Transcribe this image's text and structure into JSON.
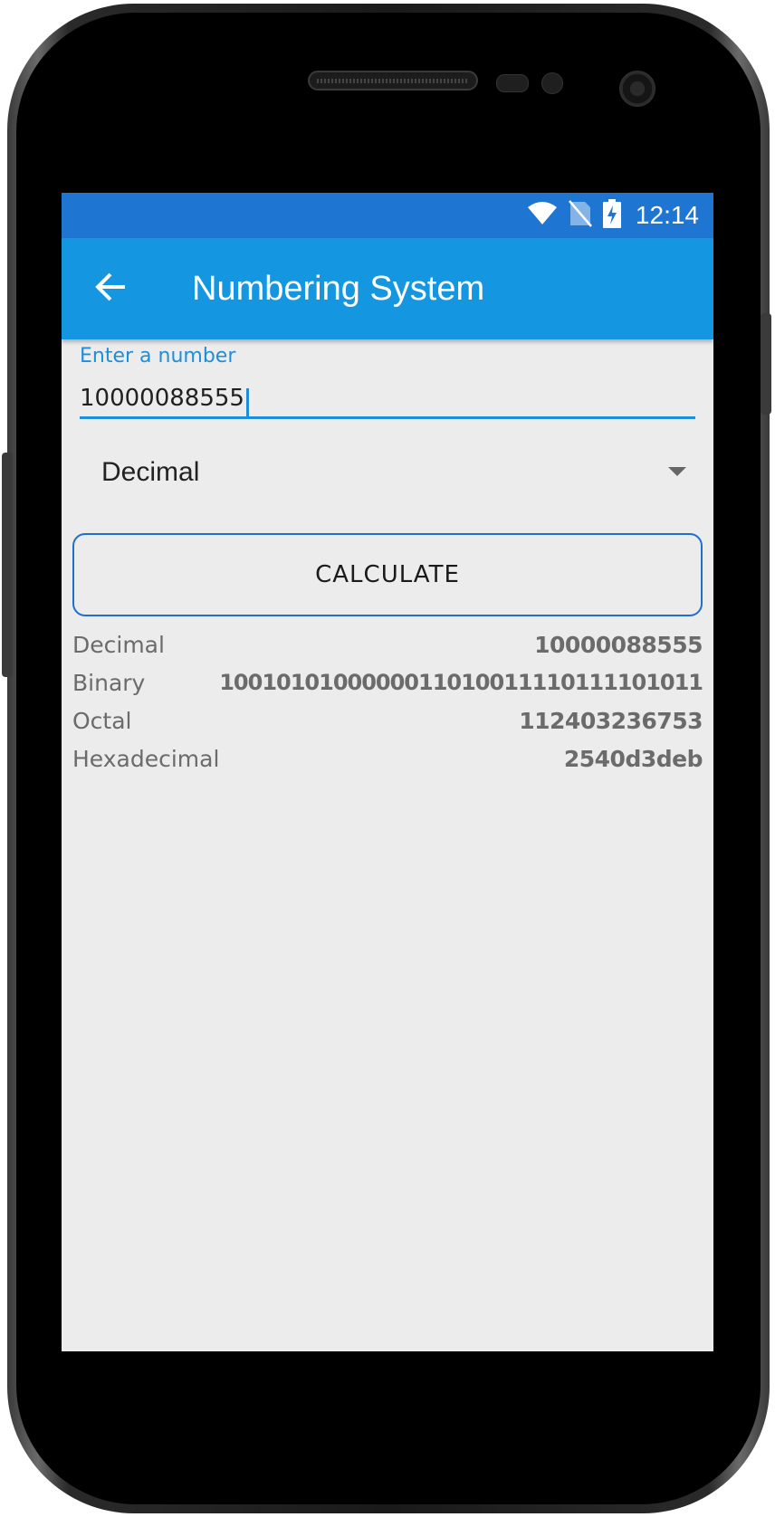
{
  "status_bar": {
    "time": "12:14",
    "icons": [
      "wifi-icon",
      "no-sim-icon",
      "battery-charging-icon"
    ]
  },
  "app_bar": {
    "back_icon": "arrow-left-icon",
    "title": "Numbering System"
  },
  "input": {
    "label": "Enter a number",
    "value": "10000088555"
  },
  "base_select": {
    "selected": "Decimal",
    "icon": "dropdown-arrow-icon"
  },
  "calculate_button": {
    "label": "CALCULATE"
  },
  "results": [
    {
      "label": "Decimal",
      "value": "10000088555"
    },
    {
      "label": "Binary",
      "value": "1001010100000011010011110111101011"
    },
    {
      "label": "Octal",
      "value": "112403236753"
    },
    {
      "label": "Hexadecimal",
      "value": "2540d3deb"
    }
  ],
  "colors": {
    "status_bar": "#1f76d2",
    "app_bar": "#1497e0",
    "accent": "#1e8ed8",
    "background": "#ececec"
  }
}
